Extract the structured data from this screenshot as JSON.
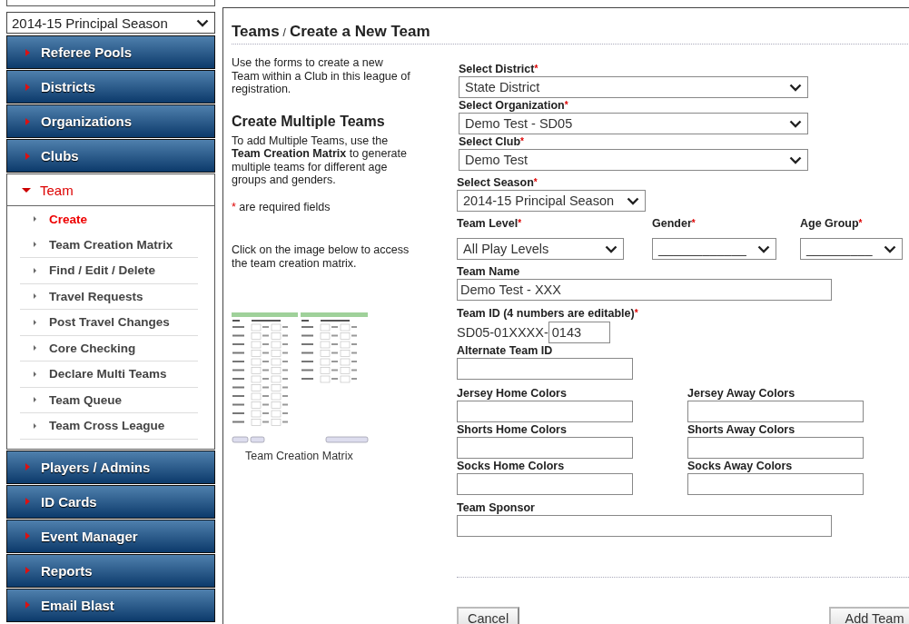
{
  "sidebar": {
    "season_select": {
      "value": "2014-15 Principal Season"
    },
    "items": [
      {
        "label": "Referee Pools",
        "expanded": false
      },
      {
        "label": "Districts",
        "expanded": false
      },
      {
        "label": "Organizations",
        "expanded": false
      },
      {
        "label": "Clubs",
        "expanded": false
      },
      {
        "label": "Team",
        "expanded": true,
        "children": [
          {
            "label": "Create",
            "selected": true
          },
          {
            "label": "Team Creation Matrix",
            "selected": false
          },
          {
            "label": "Find / Edit / Delete",
            "selected": false
          },
          {
            "label": "Travel Requests",
            "selected": false
          },
          {
            "label": "Post Travel Changes",
            "selected": false
          },
          {
            "label": "Core Checking",
            "selected": false
          },
          {
            "label": "Declare Multi Teams",
            "selected": false
          },
          {
            "label": "Team Queue",
            "selected": false
          },
          {
            "label": "Team Cross League",
            "selected": false
          }
        ]
      },
      {
        "label": "Players / Admins",
        "expanded": false
      },
      {
        "label": "ID Cards",
        "expanded": false
      },
      {
        "label": "Event Manager",
        "expanded": false
      },
      {
        "label": "Reports",
        "expanded": false
      },
      {
        "label": "Email Blast",
        "expanded": false
      }
    ]
  },
  "main": {
    "breadcrumb": {
      "section": "Teams",
      "separator": "/",
      "page": "Create a New Team"
    },
    "intro": "Use the forms to create a new Team within a Club in this league of registration.",
    "multiple_heading": "Create Multiple Teams",
    "multiple_text": "To add Multiple Teams, use the **Team Creation Matrix** to generate multiple teams for different age groups and genders.",
    "required_note": {
      "mark": "*",
      "text": "are required fields"
    },
    "matrix_hint": "Click on the image below to access the team creation matrix.",
    "matrix_caption": "Team Creation Matrix",
    "form": {
      "rows": [
        {
          "fields": [
            {
              "kind": "select",
              "label": "Select District",
              "required_mark": "*",
              "value": "State District"
            }
          ]
        },
        {
          "fields": [
            {
              "kind": "select",
              "label": "Select Organization",
              "required_mark": "*",
              "value": "Demo Test - SD05"
            }
          ]
        },
        {
          "fields": [
            {
              "kind": "select",
              "label": "Select Club",
              "required_mark": "*",
              "value": "Demo Test"
            }
          ]
        },
        {
          "fields": [
            {
              "kind": "select",
              "label": "Select Season",
              "required_mark": "*",
              "value": "2014-15 Principal Season"
            }
          ]
        },
        {
          "fields": [
            {
              "kind": "select",
              "label": "Team Level",
              "required_mark": "*",
              "value": "All Play Levels"
            },
            {
              "kind": "select",
              "label": "Gender",
              "required_mark": "*",
              "value": "____________"
            },
            {
              "kind": "select",
              "label": "Age Group",
              "required_mark": "*",
              "value": "_________"
            }
          ]
        },
        {
          "fields": [
            {
              "kind": "text",
              "label": "Team Name",
              "value": "Demo Test - XXX"
            }
          ]
        },
        {
          "fields": [
            {
              "kind": "prefixed",
              "label": "Team ID (4 numbers are editable)",
              "required_mark": "*",
              "prefix": "SD05-01XXXX-",
              "value": "0143"
            }
          ]
        },
        {
          "fields": [
            {
              "kind": "text",
              "label": "Alternate Team ID"
            }
          ]
        },
        {
          "fields": [
            {
              "kind": "text",
              "label": "Jersey Home Colors"
            },
            {
              "kind": "text",
              "label": "Jersey Away Colors"
            }
          ]
        },
        {
          "fields": [
            {
              "kind": "text",
              "label": "Shorts Home Colors"
            },
            {
              "kind": "text",
              "label": "Shorts Away Colors"
            }
          ]
        },
        {
          "fields": [
            {
              "kind": "text",
              "label": "Socks Home Colors"
            },
            {
              "kind": "text",
              "label": "Socks Away Colors"
            }
          ]
        },
        {
          "fields": [
            {
              "kind": "text",
              "label": "Team Sponsor"
            }
          ]
        }
      ],
      "buttons": [
        {
          "label": "Cancel"
        },
        {
          "label": "Add Team"
        }
      ]
    }
  }
}
